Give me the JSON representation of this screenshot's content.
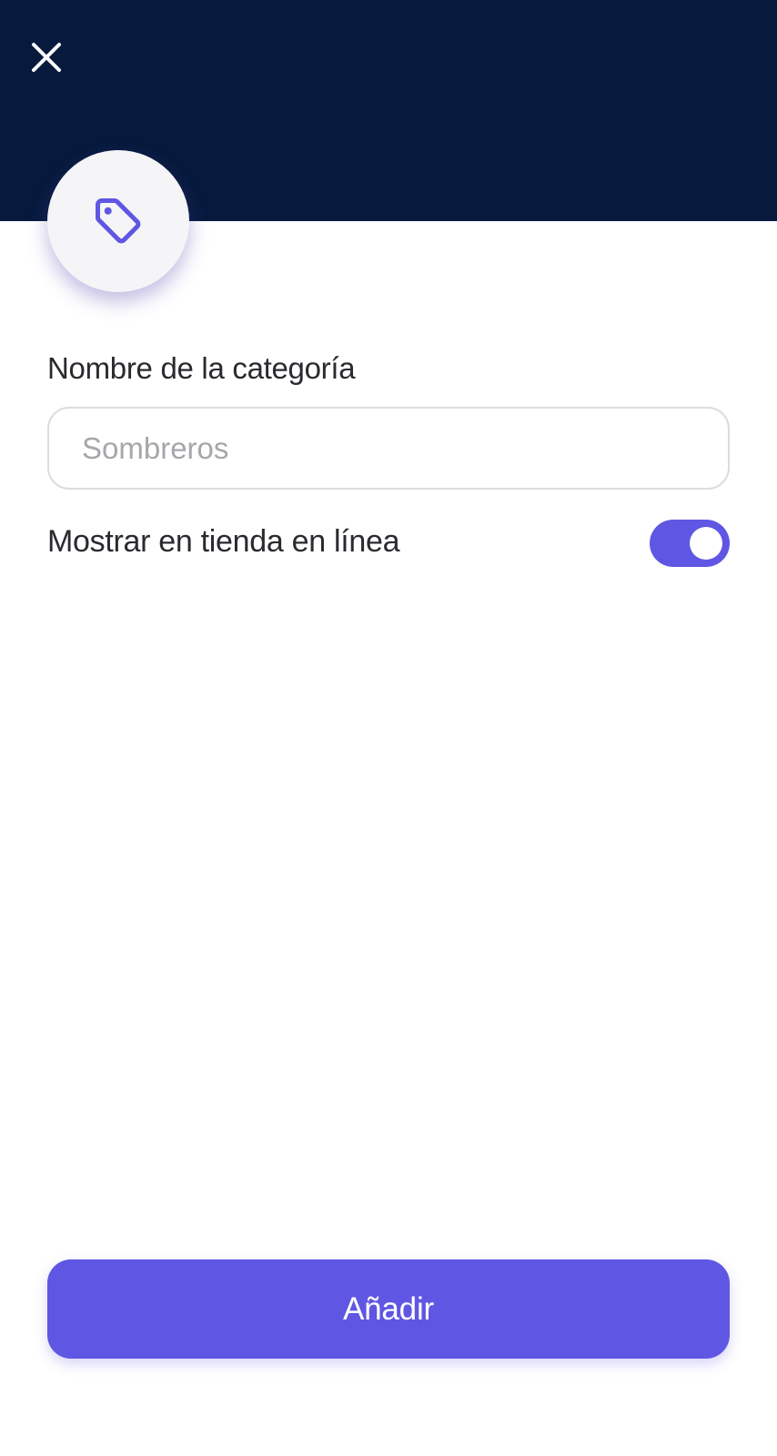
{
  "header": {
    "close_icon": "close-icon",
    "background_color": "#071a3d"
  },
  "category_icon": {
    "icon": "tag-icon",
    "color": "#5f56e3"
  },
  "form": {
    "name_label": "Nombre de la categoría",
    "name_value": "",
    "name_placeholder": "Sombreros",
    "online_store_label": "Mostrar en tienda en línea",
    "online_store_enabled": true
  },
  "actions": {
    "add_label": "Añadir",
    "accent_color": "#5f56e3"
  }
}
